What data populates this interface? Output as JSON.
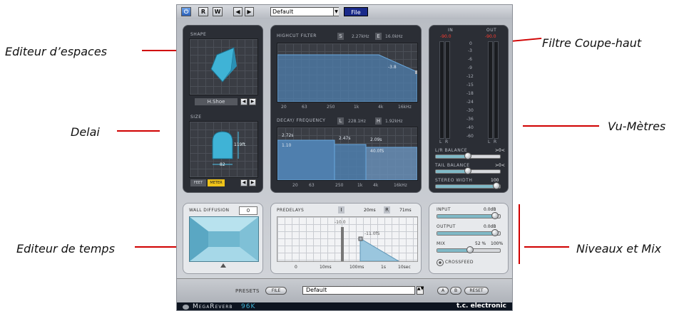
{
  "annotations": {
    "shape_editor": "Editeur d’espaces",
    "delay": "Delai",
    "time_editor": "Editeur de temps",
    "highcut_filter": "Filtre Coupe-haut",
    "vu_meters": "Vu-Mètres",
    "levels_mix": "Niveaux et Mix"
  },
  "topbar": {
    "btn_r": "R",
    "btn_w": "W",
    "btn_prev": "◀",
    "btn_next": "▶",
    "preset_select": "Default",
    "file_button": "File"
  },
  "shape": {
    "label": "SHAPE",
    "value": "H.Shoe"
  },
  "size": {
    "label": "SIZE",
    "height_value": "119ft.",
    "width_value": "82",
    "unit_feet": "FEET",
    "unit_meter": "METER"
  },
  "highcut": {
    "label": "HIGHCUT FILTER",
    "s_label": "S",
    "freq_value": "2.27kHz",
    "e_label": "E",
    "end_value": "16.0kHz",
    "curve_value": "-3.8",
    "freq_ticks": [
      "20",
      "63",
      "250",
      "1k",
      "4k",
      "16kHz"
    ]
  },
  "decay": {
    "label": "DECAY/ FREQUENCY",
    "l_label": "L",
    "low_value": "228.1Hz",
    "h_label": "H",
    "high_value": "1.92kHz",
    "band_values": [
      "2.72s",
      "2.47s",
      "2.09s"
    ],
    "band_inner": [
      "1.10",
      "",
      "40.0fS"
    ],
    "freq_ticks": [
      "20",
      "63",
      "250",
      "1k",
      "4k",
      "16kHz"
    ]
  },
  "meters": {
    "in_label": "IN",
    "out_label": "OUT",
    "in_peak": "-90.0",
    "out_peak": "-90.0",
    "scale": [
      "0",
      "-3",
      "-6",
      "-9",
      "-12",
      "-15",
      "-18",
      "-24",
      "-30",
      "-36",
      "-40",
      "-60"
    ],
    "channels": [
      "L",
      "R",
      "L",
      "R"
    ],
    "lr_balance_label": "L/R BALANCE",
    "lr_balance_value": ">0<",
    "lr_balance_level": 0.5,
    "tail_balance_label": "TAIL BALANCE",
    "tail_balance_value": ">0<",
    "tail_balance_level": 0.5,
    "stereo_width_label": "STEREO WIDTH",
    "stereo_width_value": "100",
    "stereo_width_level": 1.0
  },
  "wall": {
    "label": "WALL DIFFUSION",
    "value": "0"
  },
  "predelays": {
    "label": "PREDELAYS",
    "i_label": "I",
    "i_value": "20ms",
    "r_label": "R",
    "r_value": "71ms",
    "marker_a": "-10.0",
    "marker_b": "-11.0fS",
    "time_ticks": [
      "0",
      "10ms",
      "100ms",
      "1s",
      "10sec"
    ]
  },
  "levels": {
    "input_label": "INPUT",
    "input_value": "0.0dB",
    "input_level": 0.92,
    "output_label": "OUTPUT",
    "output_value": "0.0dB",
    "output_level": 0.92,
    "mix_label": "MIX",
    "mix_value": "52 %",
    "mix_max": "100%",
    "mix_level": 0.52,
    "crossfeed_label": "CROSSFEED"
  },
  "bottom": {
    "presets_label": "PRESETS",
    "file_pill": "FILE",
    "preset_select": "Default",
    "a_button": "A",
    "b_button": "B",
    "reset_button": "RESET",
    "brand_product_a": "MegaReverb",
    "brand_product_b": "96K",
    "brand_company": "t.c. electronic"
  }
}
